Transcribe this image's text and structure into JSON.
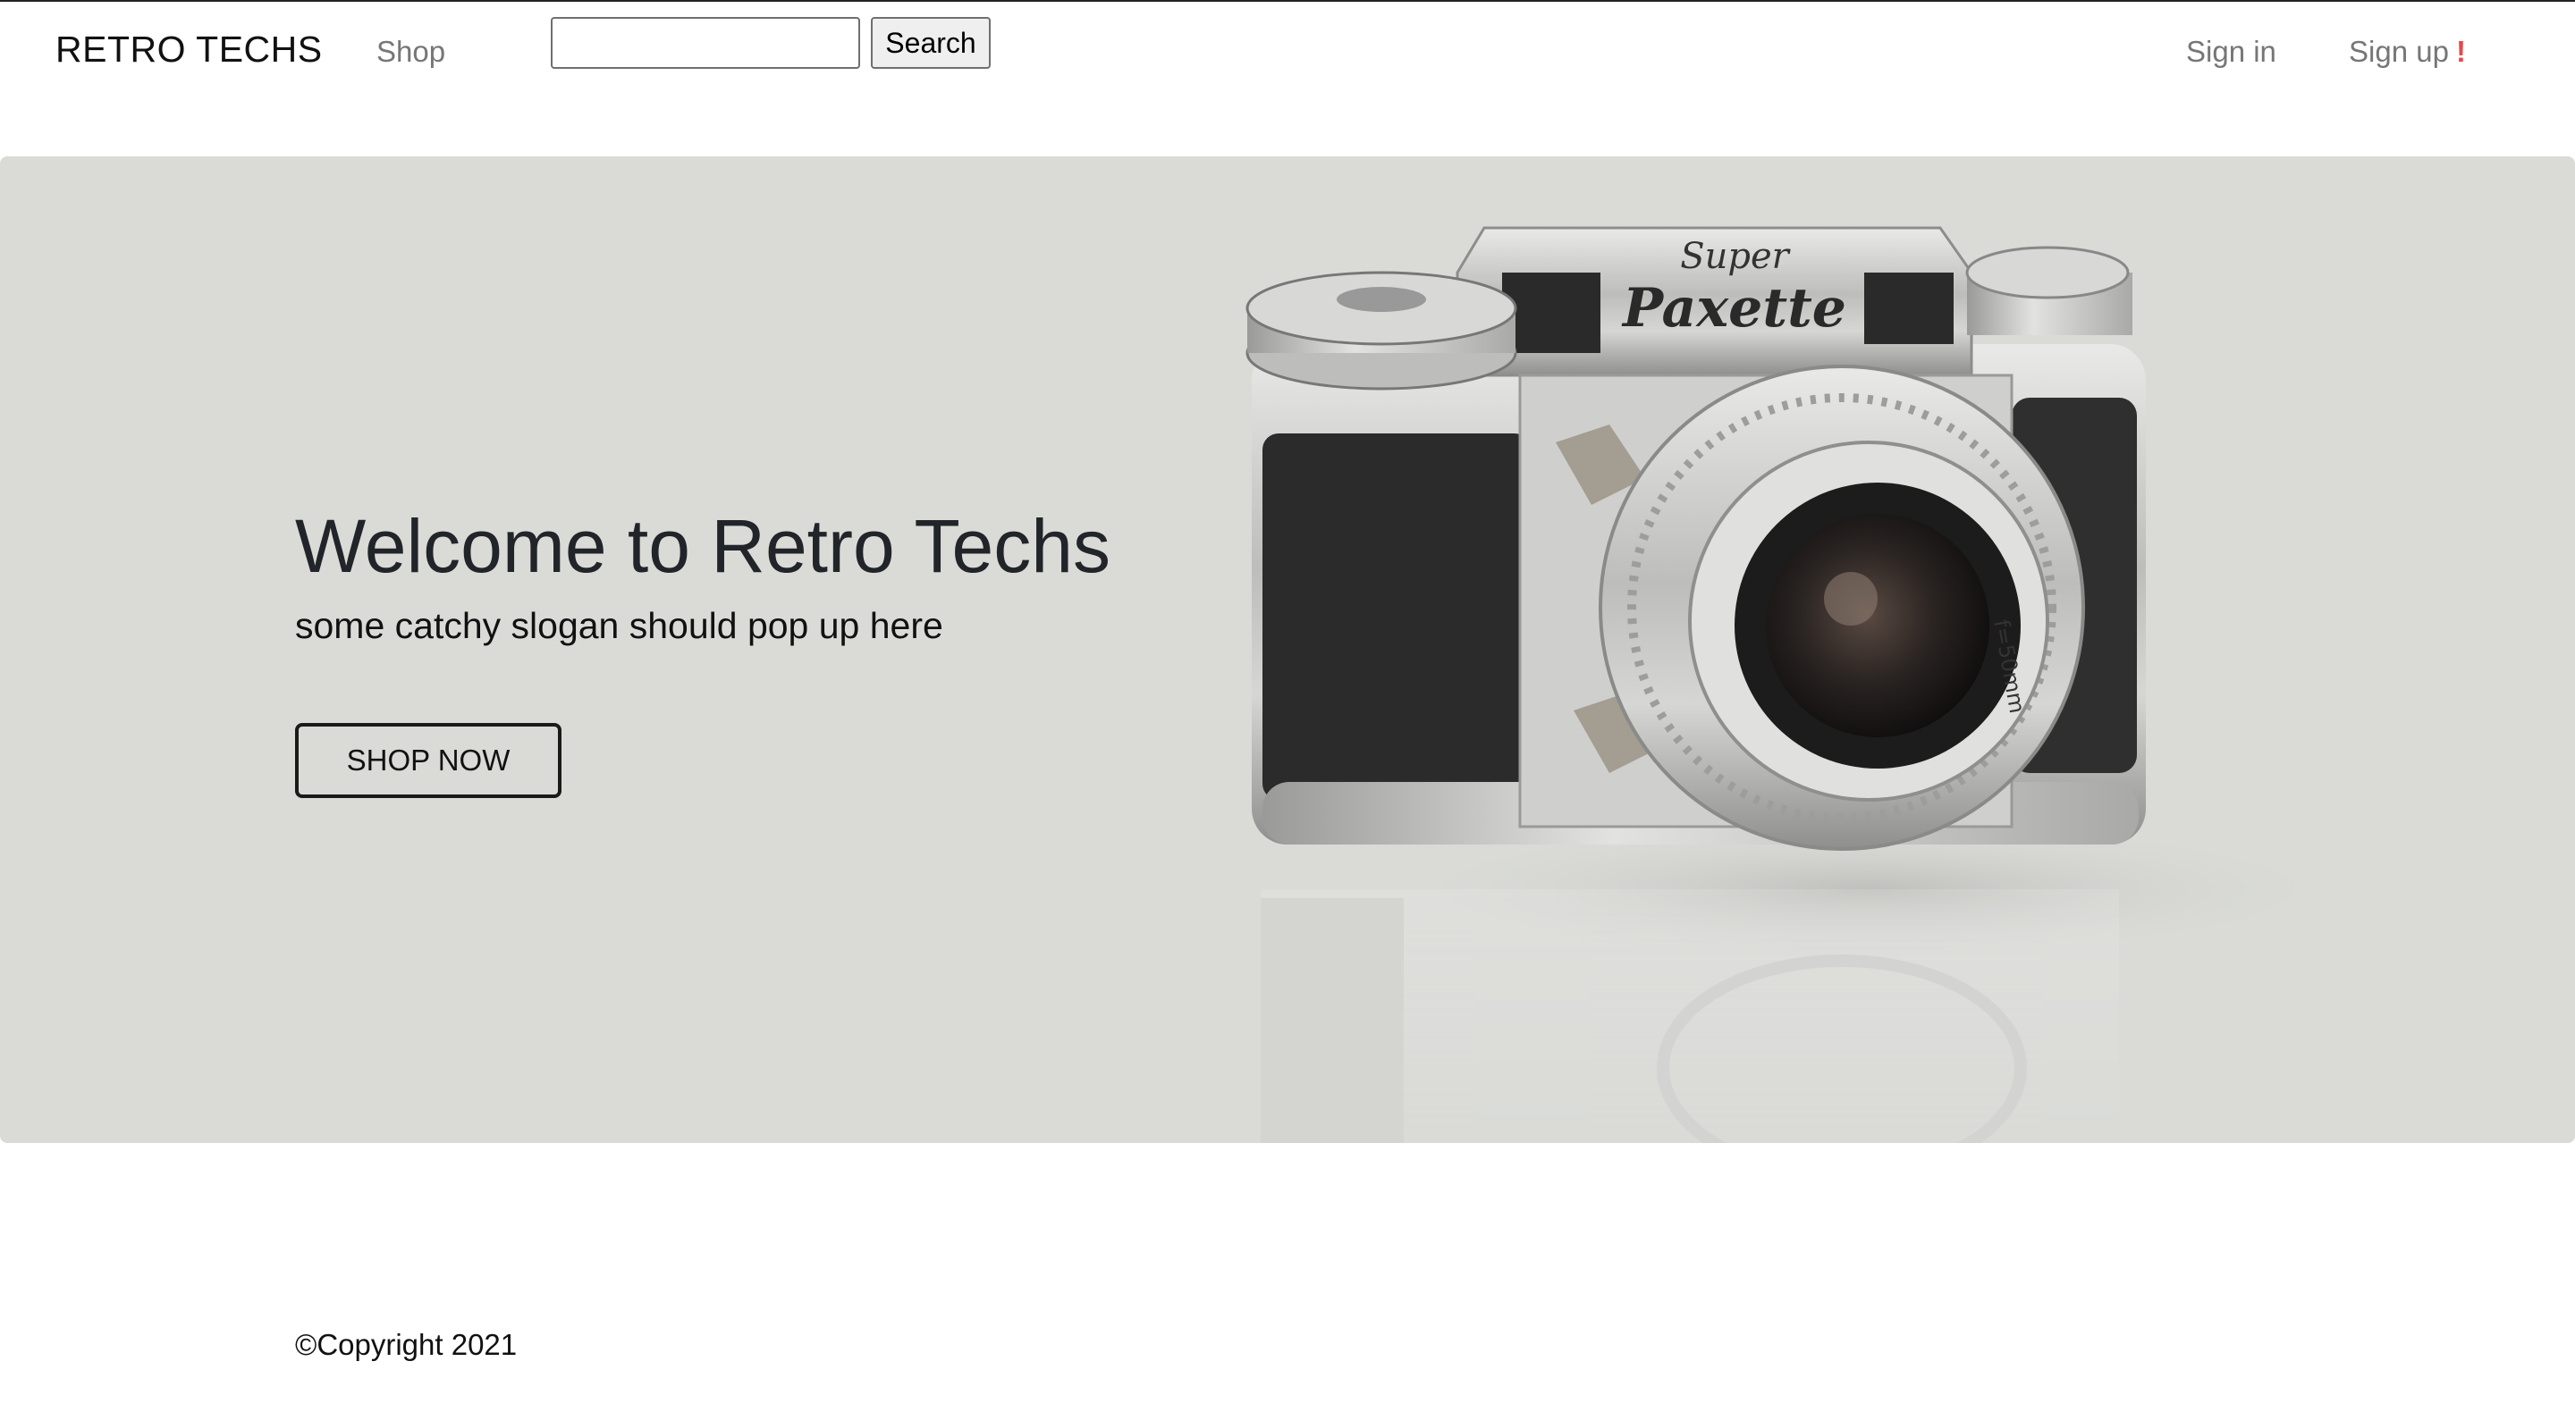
{
  "navbar": {
    "brand": "RETRO TECHS",
    "shop_label": "Shop",
    "search": {
      "value": "",
      "placeholder": "",
      "button_label": "Search"
    },
    "sign_in_label": "Sign in",
    "sign_up_label": "Sign up",
    "sign_up_badge": "!"
  },
  "hero": {
    "title": "Welcome to Retro Techs",
    "slogan": "some catchy slogan should pop up here",
    "button_label": "SHOP NOW",
    "image": {
      "subject": "vintage-camera",
      "brand_text_line1": "Super",
      "brand_text_line2": "Paxette",
      "lens_text": "f=50mm"
    }
  },
  "footer": {
    "copyright": "©Copyright 2021"
  },
  "colors": {
    "hero_background": "#dadbd7",
    "nav_link": "#767676",
    "accent_badge": "#e5484d",
    "text_dark": "#212529"
  }
}
